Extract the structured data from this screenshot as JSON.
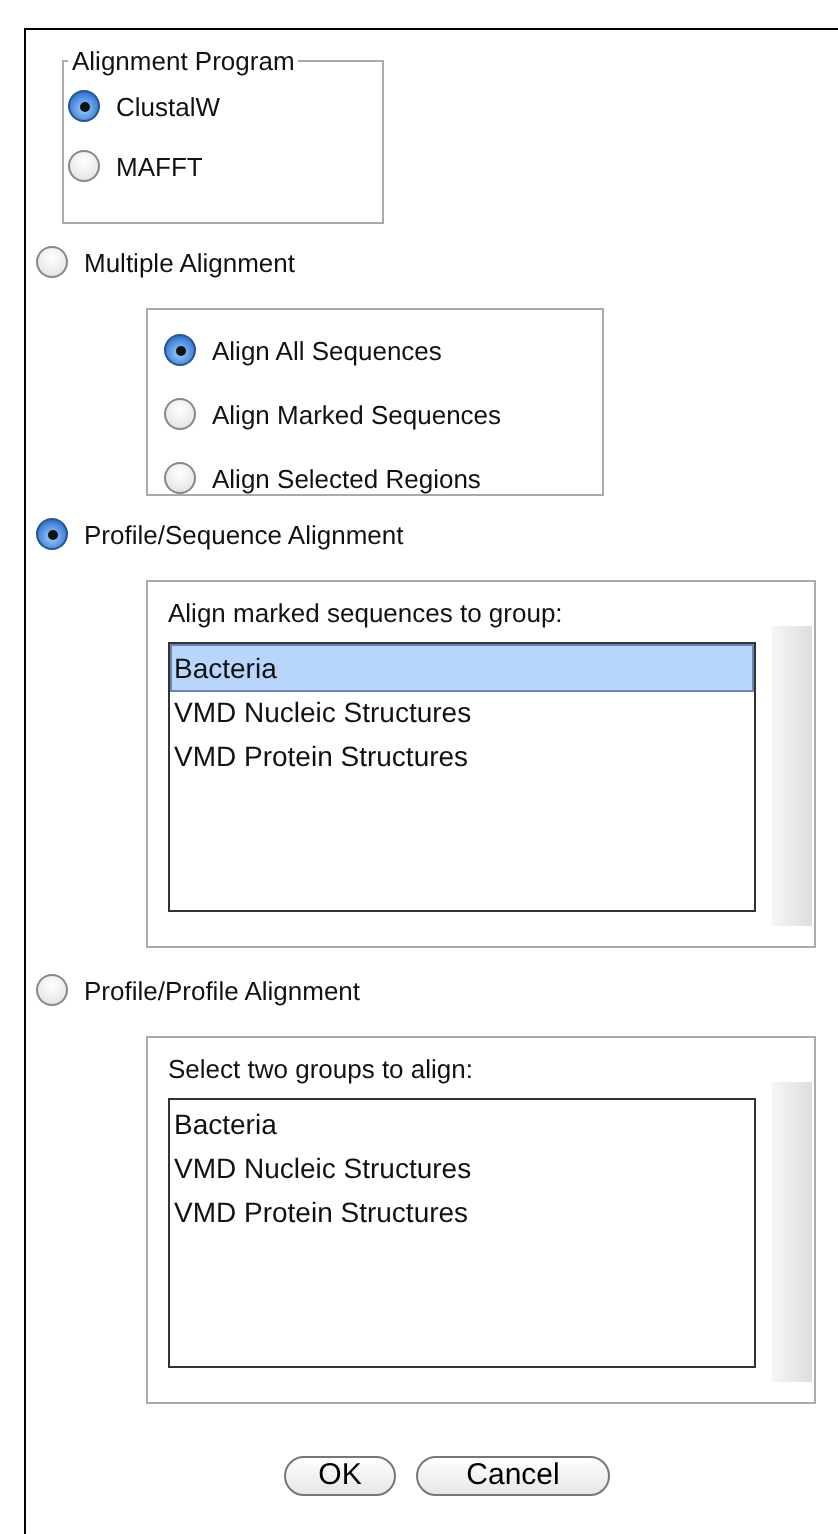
{
  "program": {
    "title": "Alignment Program",
    "options": [
      {
        "label": "ClustalW",
        "selected": true
      },
      {
        "label": "MAFFT",
        "selected": false
      }
    ]
  },
  "modes": [
    {
      "kind": "options",
      "label": "Multiple Alignment",
      "selected": false,
      "options": [
        {
          "label": "Align All Sequences",
          "selected": true
        },
        {
          "label": "Align Marked Sequences",
          "selected": false
        },
        {
          "label": "Align Selected Regions",
          "selected": false
        }
      ]
    },
    {
      "kind": "list",
      "label": "Profile/Sequence Alignment",
      "selected": true,
      "prompt": "Align marked sequences to group:",
      "groups": [
        {
          "name": "Bacteria",
          "selected": true
        },
        {
          "name": "VMD Nucleic Structures",
          "selected": false
        },
        {
          "name": "VMD Protein Structures",
          "selected": false
        }
      ]
    },
    {
      "kind": "list",
      "label": "Profile/Profile Alignment",
      "selected": false,
      "prompt": "Select two groups to align:",
      "groups": [
        {
          "name": "Bacteria",
          "selected": false
        },
        {
          "name": "VMD Nucleic Structures",
          "selected": false
        },
        {
          "name": "VMD Protein Structures",
          "selected": false
        }
      ]
    }
  ],
  "buttons": [
    "OK",
    "Cancel"
  ]
}
